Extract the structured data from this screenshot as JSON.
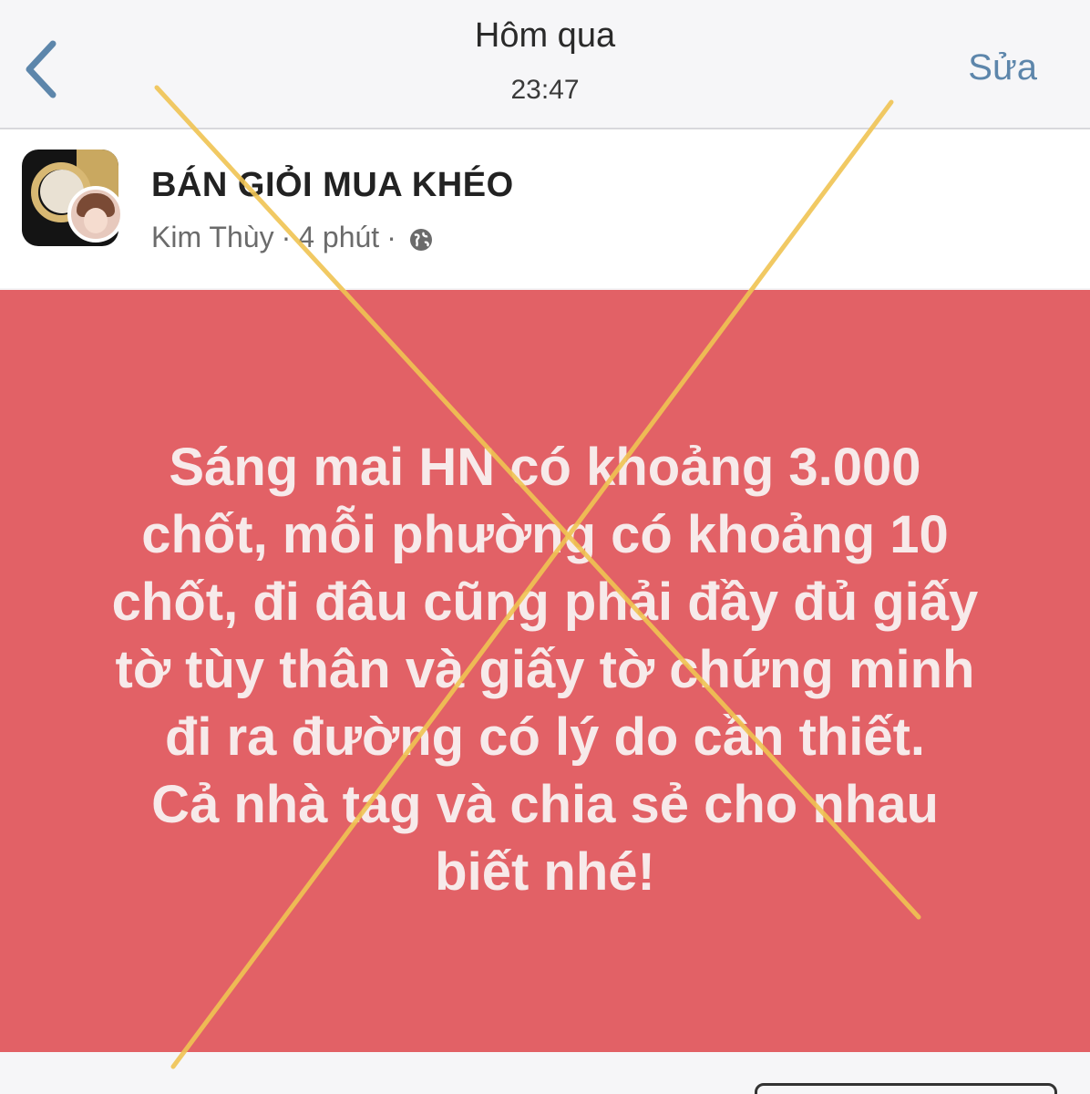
{
  "navbar": {
    "title": "Hôm qua",
    "subtitle": "23:47",
    "edit_label": "Sửa"
  },
  "post": {
    "group_name": "BÁN GIỎI MUA KHÉO",
    "author": "Kim Thùy",
    "separator": "·",
    "time_ago": "4 phút",
    "privacy_icon": "globe-icon",
    "lines": [
      "Sáng mai HN có khoảng 3.000",
      "chốt, mỗi phường có khoảng 10",
      "chốt, đi đâu cũng phải đầy đủ giấy",
      "tờ tùy thân và giấy tờ chứng minh",
      "đi ra đường có lý do cần thiết.",
      "Cả nhà tag và chia sẻ cho nhau",
      "biết nhé!"
    ],
    "background_color": "#e26166"
  },
  "overlay": {
    "cross_color": "#f0c453"
  }
}
